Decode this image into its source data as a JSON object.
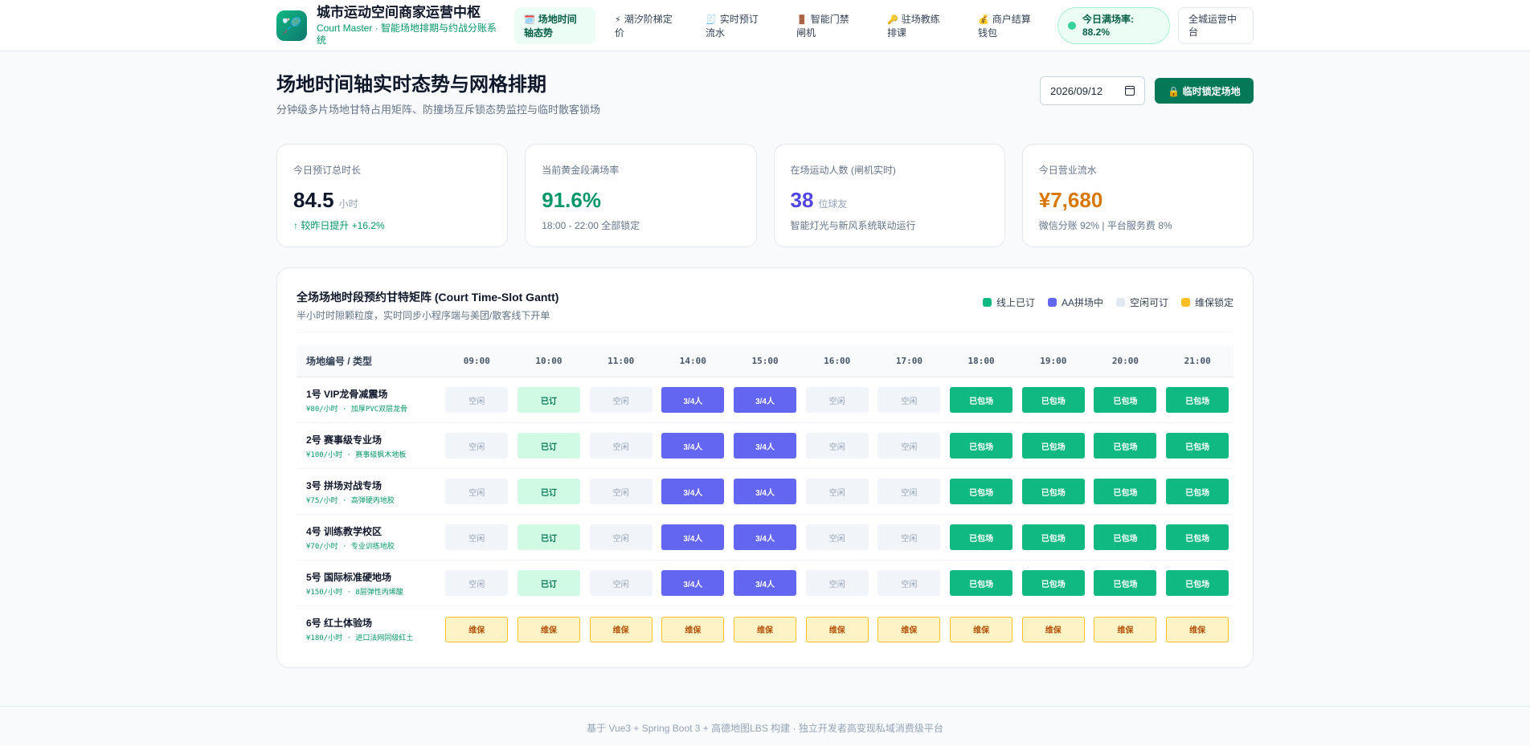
{
  "brand": {
    "title": "城市运动空间商家运营中枢",
    "subtitle": "Court Master · 智能场地排期与约战分账系统",
    "logo_icon": "badminton-icon"
  },
  "nav": [
    {
      "icon": "🗓️",
      "label": "场地时间轴态势",
      "active": true
    },
    {
      "icon": "⚡",
      "label": "潮汐阶梯定价",
      "active": false
    },
    {
      "icon": "🧾",
      "label": "实时预订流水",
      "active": false
    },
    {
      "icon": "🚪",
      "label": "智能门禁闸机",
      "active": false
    },
    {
      "icon": "🔑",
      "label": "驻场教练排课",
      "active": false
    },
    {
      "icon": "💰",
      "label": "商户结算钱包",
      "active": false
    }
  ],
  "status": {
    "label": "今日满场率: 88.2%"
  },
  "env_button": "全城运营中台",
  "page": {
    "title": "场地时间轴实时态势与网格排期",
    "subtitle": "分钟级多片场地甘特占用矩阵、防撞场互斥锁态势监控与临时散客锁场",
    "date": "2026/09/12",
    "lock_button": "🔒 临时锁定场地"
  },
  "stats": [
    {
      "label": "今日预订总时长",
      "value": "84.5",
      "unit": "小时",
      "note": "↑ 较昨日提升 +16.2%",
      "color": "#0f172a"
    },
    {
      "label": "当前黄金段满场率",
      "value": "91.6%",
      "unit": "",
      "note": "18:00 - 22:00 全部锁定",
      "color": "#059669"
    },
    {
      "label": "在场运动人数 (闸机实时)",
      "value": "38",
      "unit": "位球友",
      "note": "智能灯光与新风系统联动运行",
      "color": "#4f46e5"
    },
    {
      "label": "今日营业流水",
      "value": "¥7,680",
      "unit": "",
      "note": "微信分账 92% | 平台服务费 8%",
      "color": "#d97706"
    }
  ],
  "gantt": {
    "title": "全场场地时段预约甘特矩阵 (Court Time-Slot Gantt)",
    "subtitle": "半小时时隙颗粒度，实时同步小程序端与美团/散客线下开单",
    "legend": [
      {
        "label": "线上已订",
        "color": "#10b981"
      },
      {
        "label": "AA拼场中",
        "color": "#6366f1"
      },
      {
        "label": "空闲可订",
        "color": "#e2e8f0"
      },
      {
        "label": "维保锁定",
        "color": "#fbbf24"
      }
    ],
    "corner": "场地编号 / 类型",
    "times": [
      "09:00",
      "10:00",
      "11:00",
      "14:00",
      "15:00",
      "16:00",
      "17:00",
      "18:00",
      "19:00",
      "20:00",
      "21:00"
    ],
    "status_labels": {
      "free": "空闲",
      "booked": "已订",
      "aa": "3/4人",
      "full": "已包场",
      "maint": "维保"
    },
    "courts": [
      {
        "name": "1号 VIP龙骨减震场",
        "meta": "¥80/小时 · 加厚PVC双层龙骨",
        "slots": [
          "free",
          "booked",
          "free",
          "aa",
          "aa",
          "free",
          "free",
          "full",
          "full",
          "full",
          "full"
        ]
      },
      {
        "name": "2号 赛事级专业场",
        "meta": "¥100/小时 · 赛事级枫木地板",
        "slots": [
          "free",
          "booked",
          "free",
          "aa",
          "aa",
          "free",
          "free",
          "full",
          "full",
          "full",
          "full"
        ]
      },
      {
        "name": "3号 拼场对战专场",
        "meta": "¥75/小时 · 高弹硬丙地胶",
        "slots": [
          "free",
          "booked",
          "free",
          "aa",
          "aa",
          "free",
          "free",
          "full",
          "full",
          "full",
          "full"
        ]
      },
      {
        "name": "4号 训练教学校区",
        "meta": "¥70/小时 · 专业训练地胶",
        "slots": [
          "free",
          "booked",
          "free",
          "aa",
          "aa",
          "free",
          "free",
          "full",
          "full",
          "full",
          "full"
        ]
      },
      {
        "name": "5号 国际标准硬地场",
        "meta": "¥150/小时 · 8层弹性丙烯酸",
        "slots": [
          "free",
          "booked",
          "free",
          "aa",
          "aa",
          "free",
          "free",
          "full",
          "full",
          "full",
          "full"
        ]
      },
      {
        "name": "6号 红土体验场",
        "meta": "¥180/小时 · 进口法网同级红土",
        "slots": [
          "maint",
          "maint",
          "maint",
          "maint",
          "maint",
          "maint",
          "maint",
          "maint",
          "maint",
          "maint",
          "maint"
        ]
      }
    ]
  },
  "footer": "基于 Vue3 + Spring Boot 3 + 高德地图LBS 构建 · 独立开发者高变现私域消费级平台"
}
